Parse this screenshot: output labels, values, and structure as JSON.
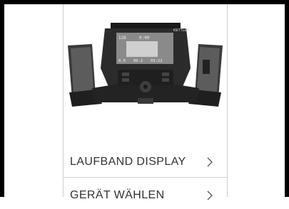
{
  "product": {
    "image_alt": "Kettler treadmill console",
    "brand": "KETTLER",
    "display_readout": {
      "top_left": "126",
      "top_mid": "0:00",
      "bottom": [
        "0.0",
        "00.2",
        "03:22"
      ]
    }
  },
  "menu": {
    "items": [
      {
        "label": "LAUFBAND DISPLAY"
      },
      {
        "label": "GERÄT WÄHLEN"
      }
    ]
  },
  "colors": {
    "frame": "#000000",
    "divider": "#cfcfcf",
    "text": "#333333",
    "console": "#2b2b2b",
    "screen": "#8a8a8a"
  }
}
